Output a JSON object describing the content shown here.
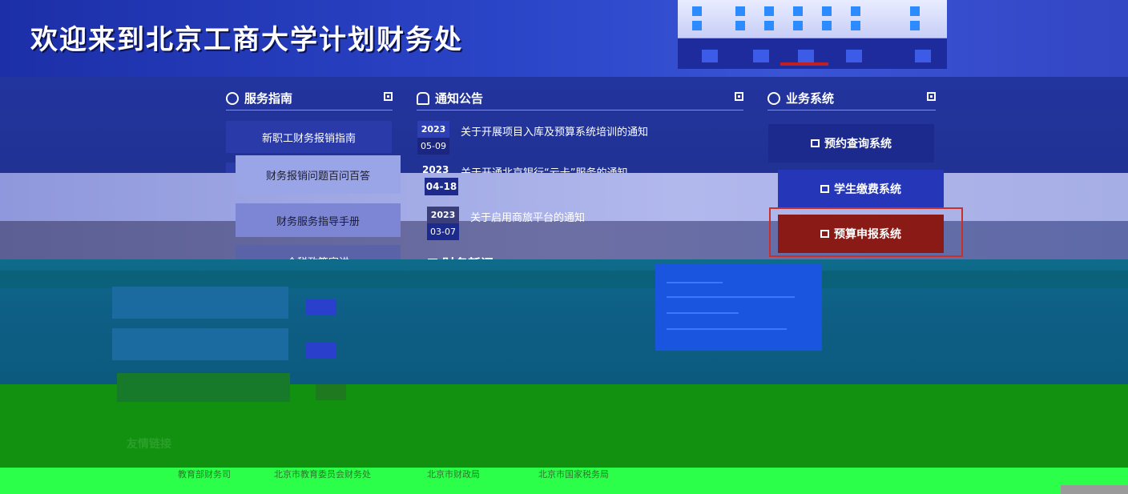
{
  "header": {
    "title": "欢迎来到北京工商大学计划财务处"
  },
  "service_guide": {
    "title": "服务指南",
    "items": [
      {
        "label": "新职工财务报销指南"
      },
      {
        "label": "财务报销问题百问百答"
      },
      {
        "label": "财务服务指导手册"
      },
      {
        "label": "个税政策宣讲"
      }
    ]
  },
  "notices": {
    "title": "通知公告",
    "items": [
      {
        "year": "2023",
        "date": "05-09",
        "title": "关于开展项目入库及预算系统培训的通知"
      },
      {
        "year": "2023",
        "date": "04-18",
        "title": "关于开通北京银行“云卡”服务的通知"
      },
      {
        "year": "2023",
        "date": "03-07",
        "title": "关于启用商旅平台的通知"
      }
    ]
  },
  "news": {
    "title": "财务新闻"
  },
  "business_systems": {
    "title": "业务系统",
    "items": [
      {
        "label": "预约查询系统",
        "color": "#1b2a8c"
      },
      {
        "label": "学生缴费系统",
        "color": "#2536b8"
      },
      {
        "label": "预算申报系统",
        "color": "#8a1a16"
      }
    ]
  },
  "friend_links": {
    "title": "友情链接",
    "items": [
      {
        "label": "教育部财务司"
      },
      {
        "label": "北京市教育委员会财务处"
      },
      {
        "label": "北京市财政局"
      },
      {
        "label": "北京市国家税务局"
      }
    ]
  }
}
